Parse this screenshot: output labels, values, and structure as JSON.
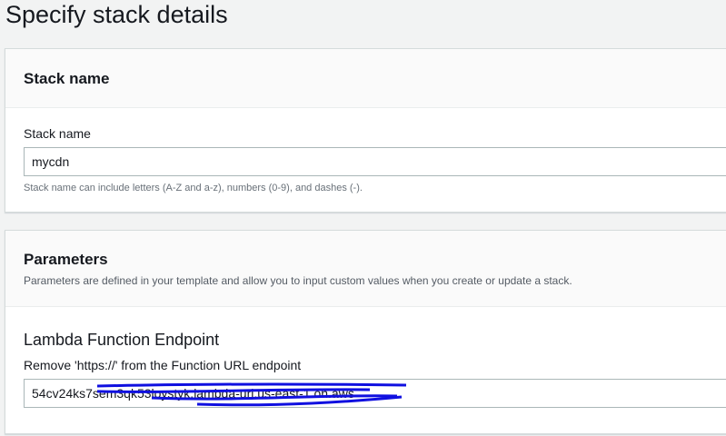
{
  "page_title": "Specify stack details",
  "stack_panel": {
    "title": "Stack name",
    "field_label": "Stack name",
    "value": "mycdn",
    "hint": "Stack name can include letters (A-Z and a-z), numbers (0-9), and dashes (-)."
  },
  "params_panel": {
    "title": "Parameters",
    "description": "Parameters are defined in your template and allow you to input custom values when you create or update a stack.",
    "section_title": "Lambda Function Endpoint",
    "field_label": "Remove 'https://' from the Function URL endpoint",
    "value": "54cv24ks7sem3qk53loystyk.lambda-url.us-east-1.on.aws",
    "redaction_color": "#1010e0"
  }
}
